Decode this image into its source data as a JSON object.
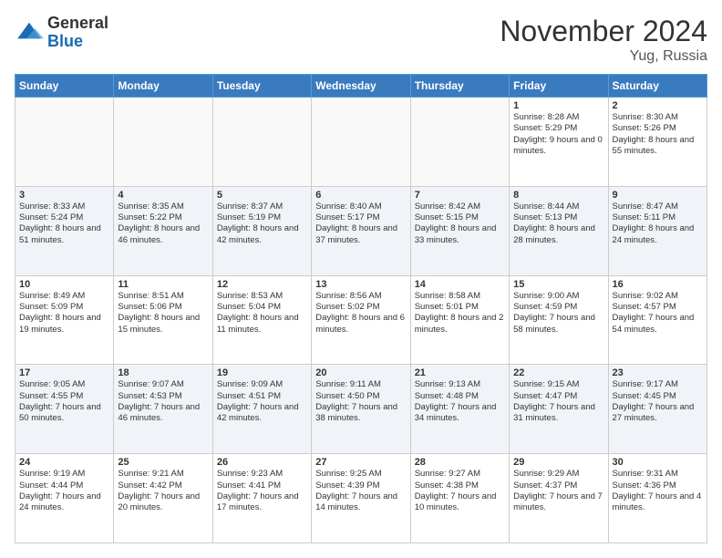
{
  "header": {
    "logo": {
      "general": "General",
      "blue": "Blue"
    },
    "title": "November 2024",
    "location": "Yug, Russia"
  },
  "days_of_week": [
    "Sunday",
    "Monday",
    "Tuesday",
    "Wednesday",
    "Thursday",
    "Friday",
    "Saturday"
  ],
  "weeks": [
    [
      {
        "day": "",
        "info": ""
      },
      {
        "day": "",
        "info": ""
      },
      {
        "day": "",
        "info": ""
      },
      {
        "day": "",
        "info": ""
      },
      {
        "day": "",
        "info": ""
      },
      {
        "day": "1",
        "info": "Sunrise: 8:28 AM\nSunset: 5:29 PM\nDaylight: 9 hours and 0 minutes."
      },
      {
        "day": "2",
        "info": "Sunrise: 8:30 AM\nSunset: 5:26 PM\nDaylight: 8 hours and 55 minutes."
      }
    ],
    [
      {
        "day": "3",
        "info": "Sunrise: 8:33 AM\nSunset: 5:24 PM\nDaylight: 8 hours and 51 minutes."
      },
      {
        "day": "4",
        "info": "Sunrise: 8:35 AM\nSunset: 5:22 PM\nDaylight: 8 hours and 46 minutes."
      },
      {
        "day": "5",
        "info": "Sunrise: 8:37 AM\nSunset: 5:19 PM\nDaylight: 8 hours and 42 minutes."
      },
      {
        "day": "6",
        "info": "Sunrise: 8:40 AM\nSunset: 5:17 PM\nDaylight: 8 hours and 37 minutes."
      },
      {
        "day": "7",
        "info": "Sunrise: 8:42 AM\nSunset: 5:15 PM\nDaylight: 8 hours and 33 minutes."
      },
      {
        "day": "8",
        "info": "Sunrise: 8:44 AM\nSunset: 5:13 PM\nDaylight: 8 hours and 28 minutes."
      },
      {
        "day": "9",
        "info": "Sunrise: 8:47 AM\nSunset: 5:11 PM\nDaylight: 8 hours and 24 minutes."
      }
    ],
    [
      {
        "day": "10",
        "info": "Sunrise: 8:49 AM\nSunset: 5:09 PM\nDaylight: 8 hours and 19 minutes."
      },
      {
        "day": "11",
        "info": "Sunrise: 8:51 AM\nSunset: 5:06 PM\nDaylight: 8 hours and 15 minutes."
      },
      {
        "day": "12",
        "info": "Sunrise: 8:53 AM\nSunset: 5:04 PM\nDaylight: 8 hours and 11 minutes."
      },
      {
        "day": "13",
        "info": "Sunrise: 8:56 AM\nSunset: 5:02 PM\nDaylight: 8 hours and 6 minutes."
      },
      {
        "day": "14",
        "info": "Sunrise: 8:58 AM\nSunset: 5:01 PM\nDaylight: 8 hours and 2 minutes."
      },
      {
        "day": "15",
        "info": "Sunrise: 9:00 AM\nSunset: 4:59 PM\nDaylight: 7 hours and 58 minutes."
      },
      {
        "day": "16",
        "info": "Sunrise: 9:02 AM\nSunset: 4:57 PM\nDaylight: 7 hours and 54 minutes."
      }
    ],
    [
      {
        "day": "17",
        "info": "Sunrise: 9:05 AM\nSunset: 4:55 PM\nDaylight: 7 hours and 50 minutes."
      },
      {
        "day": "18",
        "info": "Sunrise: 9:07 AM\nSunset: 4:53 PM\nDaylight: 7 hours and 46 minutes."
      },
      {
        "day": "19",
        "info": "Sunrise: 9:09 AM\nSunset: 4:51 PM\nDaylight: 7 hours and 42 minutes."
      },
      {
        "day": "20",
        "info": "Sunrise: 9:11 AM\nSunset: 4:50 PM\nDaylight: 7 hours and 38 minutes."
      },
      {
        "day": "21",
        "info": "Sunrise: 9:13 AM\nSunset: 4:48 PM\nDaylight: 7 hours and 34 minutes."
      },
      {
        "day": "22",
        "info": "Sunrise: 9:15 AM\nSunset: 4:47 PM\nDaylight: 7 hours and 31 minutes."
      },
      {
        "day": "23",
        "info": "Sunrise: 9:17 AM\nSunset: 4:45 PM\nDaylight: 7 hours and 27 minutes."
      }
    ],
    [
      {
        "day": "24",
        "info": "Sunrise: 9:19 AM\nSunset: 4:44 PM\nDaylight: 7 hours and 24 minutes."
      },
      {
        "day": "25",
        "info": "Sunrise: 9:21 AM\nSunset: 4:42 PM\nDaylight: 7 hours and 20 minutes."
      },
      {
        "day": "26",
        "info": "Sunrise: 9:23 AM\nSunset: 4:41 PM\nDaylight: 7 hours and 17 minutes."
      },
      {
        "day": "27",
        "info": "Sunrise: 9:25 AM\nSunset: 4:39 PM\nDaylight: 7 hours and 14 minutes."
      },
      {
        "day": "28",
        "info": "Sunrise: 9:27 AM\nSunset: 4:38 PM\nDaylight: 7 hours and 10 minutes."
      },
      {
        "day": "29",
        "info": "Sunrise: 9:29 AM\nSunset: 4:37 PM\nDaylight: 7 hours and 7 minutes."
      },
      {
        "day": "30",
        "info": "Sunrise: 9:31 AM\nSunset: 4:36 PM\nDaylight: 7 hours and 4 minutes."
      }
    ]
  ]
}
